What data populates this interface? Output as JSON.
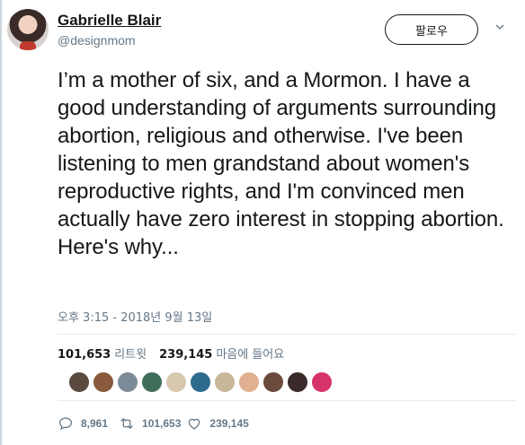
{
  "user": {
    "display_name": "Gabrielle Blair",
    "handle": "@designmom"
  },
  "follow_label": "팔로우",
  "tweet_text": "I’m a mother of six, and a Mormon. I have a good understanding of arguments surrounding abortion, religious and otherwise. I've been listening to men grandstand about women's reproductive rights, and I'm convinced men actually have zero interest in stopping abortion. Here's why...",
  "timestamp": "오후 3:15 - 2018년 9월 13일",
  "stats": {
    "retweets_count": "101,653",
    "retweets_label": "리트윗",
    "likes_count": "239,145",
    "likes_label": "마음에 들어요"
  },
  "liker_colors": [
    "#5a4a3f",
    "#8a5a3c",
    "#7d8b99",
    "#3f6f5a",
    "#d8c8b0",
    "#2f6a8f",
    "#c9b79a",
    "#e0b090",
    "#6b4b3b",
    "#3a2a2a",
    "#d6336c"
  ],
  "actions": {
    "replies": "8,961",
    "retweets": "101,653",
    "likes": "239,145"
  },
  "colors": {
    "text": "#14171a",
    "secondary": "#657786",
    "divider": "#e6ecf0"
  }
}
